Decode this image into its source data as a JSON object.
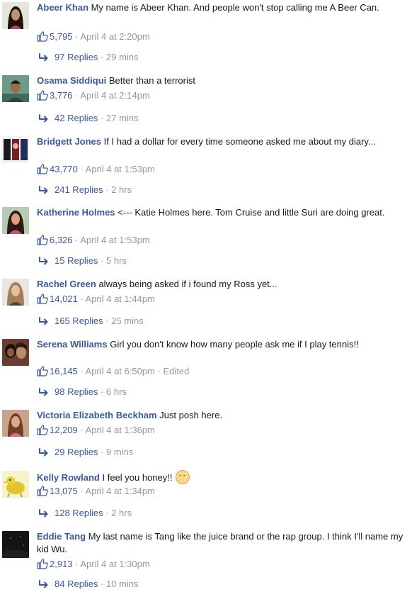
{
  "comments": [
    {
      "author": "Abeer Khan",
      "text": "My name is Abeer Khan. And people won't stop calling me A Beer Can.",
      "likes": "5,795",
      "time": "April 4 at 2:20pm",
      "edited": "",
      "replies": "97 Replies",
      "reply_time": "29 mins"
    },
    {
      "author": "Osama Siddiqui",
      "text": "Better than a terrorist",
      "likes": "3,776",
      "time": "April 4 at 2:14pm",
      "edited": "",
      "replies": "42 Replies",
      "reply_time": "27 mins"
    },
    {
      "author": "Bridgett Jones",
      "text": "If I had a dollar for every time someone asked me about my diary...",
      "likes": "43,770",
      "time": "April 4 at 1:53pm",
      "edited": "",
      "replies": "241 Replies",
      "reply_time": "2 hrs"
    },
    {
      "author": "Katherine Holmes",
      "text": "<--- Katie Holmes here. Tom Cruise and little Suri are doing great.",
      "likes": "6,326",
      "time": "April 4 at 1:53pm",
      "edited": "",
      "replies": "15 Replies",
      "reply_time": "5 hrs"
    },
    {
      "author": "Rachel Green",
      "text": "always being asked if i found my Ross yet...",
      "likes": "14,021",
      "time": "April 4 at 1:44pm",
      "edited": "",
      "replies": "165 Replies",
      "reply_time": "25 mins"
    },
    {
      "author": "Serena Williams",
      "text": "Girl you don't know how many people ask me if I play tennis!!",
      "likes": "16,145",
      "time": "April 4 at 6:50pm",
      "edited": "Edited",
      "replies": "98 Replies",
      "reply_time": "6 hrs"
    },
    {
      "author": "Victoria Elizabeth Beckham",
      "text": "Just posh here.",
      "likes": "12,209",
      "time": "April 4 at 1:36pm",
      "edited": "",
      "replies": "29 Replies",
      "reply_time": "9 mins"
    },
    {
      "author": "Kelly Rowland",
      "text": "I feel you honey!!",
      "likes": "13,075",
      "time": "April 4 at 1:34pm",
      "edited": "",
      "replies": "128 Replies",
      "reply_time": "2 hrs"
    },
    {
      "author": "Eddie Tang",
      "text": "My last name is Tang like the juice brand or the rap group. I think I'll name my kid Wu.",
      "likes": "2,913",
      "time": "April 4 at 1:30pm",
      "edited": "",
      "replies": "84 Replies",
      "reply_time": "10 mins"
    }
  ],
  "separator": " · ",
  "colors": {
    "link": "#3b5998",
    "meta": "#9197a3",
    "text": "#141823"
  },
  "icons": {
    "like": "thumbs-up-icon",
    "reply": "reply-arrow-icon",
    "emoji": "smiley-emoji-icon"
  }
}
